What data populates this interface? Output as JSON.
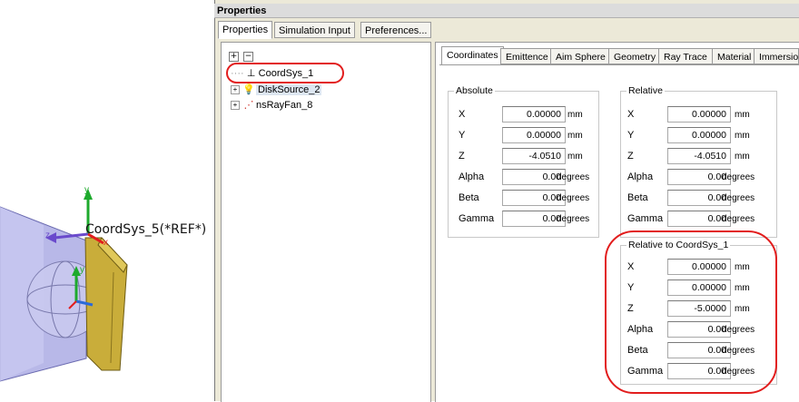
{
  "viewport": {
    "ref_label": "CoordSys_5(*REF*)",
    "axis_labels": {
      "y_top": "y",
      "x": "x",
      "z": "z",
      "y_bottom": "y"
    }
  },
  "window": {
    "title": "Properties"
  },
  "top_tabs": [
    {
      "label": "Properties",
      "active": true
    },
    {
      "label": "Simulation Input",
      "active": false
    },
    {
      "label": "Preferences...",
      "active": false
    }
  ],
  "tree": {
    "expand_all": "+",
    "collapse_all": "−",
    "items": [
      {
        "label": "CoordSys_1",
        "icon": "coordsys-icon",
        "highlighted": true
      },
      {
        "label": "DiskSource_2",
        "icon": "lightbulb-icon",
        "expander": "+"
      },
      {
        "label": "nsRayFan_8",
        "icon": "rayfan-icon",
        "expander": "+"
      }
    ]
  },
  "detail_tabs": [
    {
      "label": "Coordinates",
      "active": true
    },
    {
      "label": "Emittence"
    },
    {
      "label": "Aim Sphere"
    },
    {
      "label": "Geometry"
    },
    {
      "label": "Ray Trace"
    },
    {
      "label": "Material"
    },
    {
      "label": "Immersio"
    }
  ],
  "groups": {
    "absolute": {
      "title": "Absolute",
      "rows": [
        {
          "label": "X",
          "value": "0.00000",
          "unit": "mm"
        },
        {
          "label": "Y",
          "value": "0.00000",
          "unit": "mm"
        },
        {
          "label": "Z",
          "value": "-4.0510",
          "unit": "mm"
        },
        {
          "label": "Alpha",
          "value": "0.00",
          "unit": "degrees"
        },
        {
          "label": "Beta",
          "value": "0.00",
          "unit": "degrees"
        },
        {
          "label": "Gamma",
          "value": "0.00",
          "unit": "degrees"
        }
      ]
    },
    "relative": {
      "title": "Relative",
      "rows": [
        {
          "label": "X",
          "value": "0.00000",
          "unit": "mm"
        },
        {
          "label": "Y",
          "value": "0.00000",
          "unit": "mm"
        },
        {
          "label": "Z",
          "value": "-4.0510",
          "unit": "mm"
        },
        {
          "label": "Alpha",
          "value": "0.00",
          "unit": "degrees"
        },
        {
          "label": "Beta",
          "value": "0.00",
          "unit": "degrees"
        },
        {
          "label": "Gamma",
          "value": "0.00",
          "unit": "degrees"
        }
      ]
    },
    "relative_to": {
      "title": "Relative to CoordSys_1",
      "rows": [
        {
          "label": "X",
          "value": "0.00000",
          "unit": "mm"
        },
        {
          "label": "Y",
          "value": "0.00000",
          "unit": "mm"
        },
        {
          "label": "Z",
          "value": "-5.0000",
          "unit": "mm"
        },
        {
          "label": "Alpha",
          "value": "0.00",
          "unit": "degrees"
        },
        {
          "label": "Beta",
          "value": "0.00",
          "unit": "degrees"
        },
        {
          "label": "Gamma",
          "value": "0.00",
          "unit": "degrees"
        }
      ]
    }
  },
  "colors": {
    "annotation": "#e21d1d",
    "selection": "#dde6f1"
  }
}
